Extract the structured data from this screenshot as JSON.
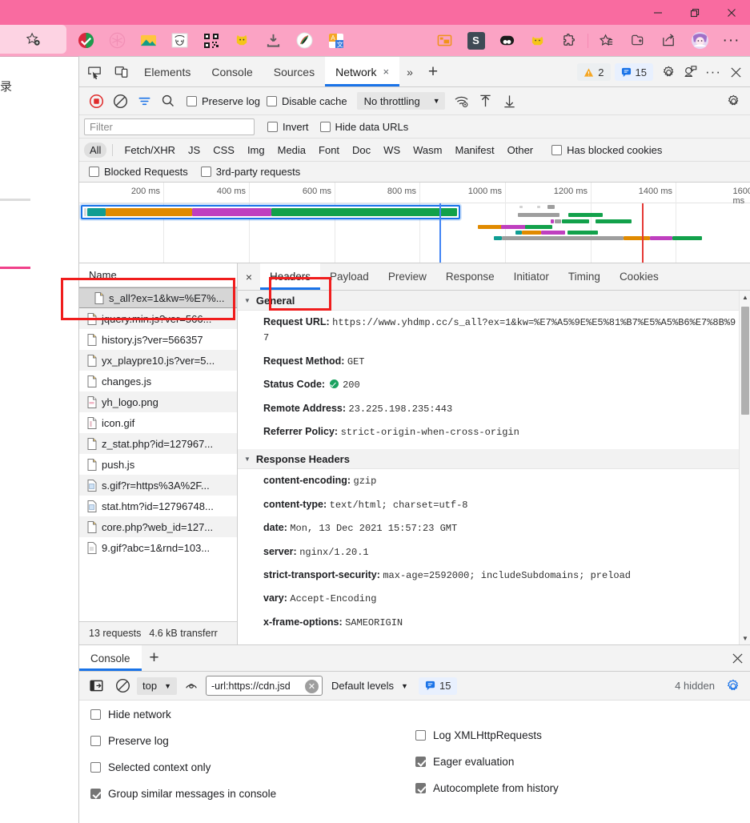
{
  "browser": {
    "window_controls": [
      "minimize",
      "restore",
      "close"
    ],
    "favorite_chip_icon": "add-favorite-star-icon",
    "extension_icons": [
      "adblock-icon",
      "flower-circle-icon",
      "image-icon",
      "anime-face-icon",
      "qr-code-icon",
      "cat-icon",
      "download-icon",
      "colorful-pen-icon",
      "translate-icon"
    ],
    "right_icons": [
      "picture-in-picture-icon",
      "s-extension-icon",
      "panda-icon",
      "cat2-icon",
      "puzzle-icon"
    ],
    "right_icons2": [
      "favorites-icon",
      "collections-icon",
      "share-icon",
      "profile-avatar",
      "more-icon"
    ]
  },
  "page_sliver": {
    "text": "录"
  },
  "devtools": {
    "tool_icons": [
      "inspect-element-icon",
      "device-toolbar-icon"
    ],
    "tabs": [
      {
        "label": "Elements",
        "active": false
      },
      {
        "label": "Console",
        "active": false
      },
      {
        "label": "Sources",
        "active": false
      },
      {
        "label": "Network",
        "active": true,
        "closable": true
      }
    ],
    "more_tabs_icon": "chevron-double-right-icon",
    "add_tab_icon": "plus-icon",
    "close_label": "×",
    "warnings": {
      "icon": "warning-triangle-icon",
      "count": "2"
    },
    "messages": {
      "icon": "message-bubble-icon",
      "count": "15"
    },
    "right_icons": [
      "settings-gear-icon",
      "customize-devtools-icon",
      "more-options-icon",
      "close-devtools-icon"
    ]
  },
  "network_toolbar": {
    "record_icon": "record-stop-icon",
    "clear_icon": "clear-circle-slash-icon",
    "filter_icon": "filter-icon",
    "search_icon": "search-icon",
    "preserve_log": {
      "label": "Preserve log",
      "checked": false
    },
    "disable_cache": {
      "label": "Disable cache",
      "checked": false
    },
    "throttling": {
      "value": "No throttling"
    },
    "wifi_icon": "network-conditions-wifi-icon",
    "upload_icon": "import-har-arrow-up-icon",
    "download_icon": "export-har-arrow-down-icon",
    "settings_icon": "settings-gear-icon"
  },
  "filter_row": {
    "placeholder": "Filter",
    "value": "",
    "invert": {
      "label": "Invert",
      "checked": false
    },
    "hide_data_urls": {
      "label": "Hide data URLs",
      "checked": false
    }
  },
  "type_filters": [
    {
      "label": "All",
      "active": true
    },
    {
      "label": "Fetch/XHR",
      "active": false
    },
    {
      "label": "JS",
      "active": false
    },
    {
      "label": "CSS",
      "active": false
    },
    {
      "label": "Img",
      "active": false
    },
    {
      "label": "Media",
      "active": false
    },
    {
      "label": "Font",
      "active": false
    },
    {
      "label": "Doc",
      "active": false
    },
    {
      "label": "WS",
      "active": false
    },
    {
      "label": "Wasm",
      "active": false
    },
    {
      "label": "Manifest",
      "active": false
    },
    {
      "label": "Other",
      "active": false
    }
  ],
  "has_blocked_cookies": {
    "label": "Has blocked cookies",
    "checked": false
  },
  "blocked_row": [
    {
      "label": "Blocked Requests",
      "checked": false
    },
    {
      "label": "3rd-party requests",
      "checked": false
    }
  ],
  "overview": {
    "tick_labels": [
      "200 ms",
      "400 ms",
      "600 ms",
      "800 ms",
      "1000 ms",
      "1200 ms",
      "1400 ms",
      "1600 ms"
    ],
    "dom_content_loaded_ms": 905,
    "load_event_ms": 1400
  },
  "request_list": {
    "column_header": "Name",
    "rows": [
      {
        "name": "s_all?ex=1&kw=%E7%...",
        "icon": "document-file-icon",
        "selected": true
      },
      {
        "name": "jquery.min.js?ver=566...",
        "icon": "script-file-icon",
        "selected": false
      },
      {
        "name": "history.js?ver=566357",
        "icon": "script-file-icon",
        "selected": false
      },
      {
        "name": "yx_playpre10.js?ver=5...",
        "icon": "script-file-icon",
        "selected": false
      },
      {
        "name": "changes.js",
        "icon": "script-file-icon",
        "selected": false
      },
      {
        "name": "yh_logo.png",
        "icon": "image-file-icon",
        "selected": false
      },
      {
        "name": "icon.gif",
        "icon": "image-file-icon",
        "selected": false
      },
      {
        "name": "z_stat.php?id=127967...",
        "icon": "script-file-icon",
        "selected": false
      },
      {
        "name": "push.js",
        "icon": "script-file-icon",
        "selected": false
      },
      {
        "name": "s.gif?r=https%3A%2F...",
        "icon": "image-file-icon",
        "selected": false
      },
      {
        "name": "stat.htm?id=12796748...",
        "icon": "document-file-icon",
        "selected": false
      },
      {
        "name": "core.php?web_id=127...",
        "icon": "script-file-icon",
        "selected": false
      },
      {
        "name": "9.gif?abc=1&rnd=103...",
        "icon": "image-file-icon",
        "selected": false
      }
    ],
    "status": {
      "requests": "13 requests",
      "transferred": "4.6 kB transferr"
    }
  },
  "detail": {
    "close_icon": "×",
    "tabs": [
      {
        "label": "Headers",
        "active": true
      },
      {
        "label": "Payload",
        "active": false
      },
      {
        "label": "Preview",
        "active": false
      },
      {
        "label": "Response",
        "active": false
      },
      {
        "label": "Initiator",
        "active": false
      },
      {
        "label": "Timing",
        "active": false
      },
      {
        "label": "Cookies",
        "active": false
      }
    ],
    "general": {
      "title": "General",
      "items": [
        {
          "key": "Request URL:",
          "value": "https://www.yhdmp.cc/s_all?ex=1&kw=%E7%A5%9E%E5%81%B7%E5%A5%B6%E7%8B%97"
        },
        {
          "key": "Request Method:",
          "value": "GET"
        },
        {
          "key": "Status Code:",
          "value": "200",
          "status_icon": "green-check-circle-icon"
        },
        {
          "key": "Remote Address:",
          "value": "23.225.198.235:443"
        },
        {
          "key": "Referrer Policy:",
          "value": "strict-origin-when-cross-origin"
        }
      ]
    },
    "response_headers": {
      "title": "Response Headers",
      "items": [
        {
          "key": "content-encoding:",
          "value": "gzip"
        },
        {
          "key": "content-type:",
          "value": "text/html; charset=utf-8"
        },
        {
          "key": "date:",
          "value": "Mon, 13 Dec 2021 15:57:23 GMT"
        },
        {
          "key": "server:",
          "value": "nginx/1.20.1"
        },
        {
          "key": "strict-transport-security:",
          "value": "max-age=2592000; includeSubdomains; preload"
        },
        {
          "key": "vary:",
          "value": "Accept-Encoding"
        },
        {
          "key": "x-frame-options:",
          "value": "SAMEORIGIN"
        }
      ]
    }
  },
  "drawer": {
    "tabs": [
      {
        "label": "Console",
        "active": true
      }
    ],
    "add_icon": "plus-icon",
    "close_icon": "×",
    "toolbar": {
      "sidebar_icon": "console-sidebar-icon",
      "clear_icon": "clear-console-icon",
      "context": "top",
      "eye_icon": "live-expression-eye-icon",
      "filter_value": "-url:https://cdn.jsd",
      "filter_placeholder": "Filter",
      "clear_filter_icon": "clear-input-icon",
      "levels": "Default levels",
      "message_count": "15",
      "message_icon": "message-bubble-icon",
      "hidden": "4 hidden",
      "settings_icon": "settings-gear-icon"
    },
    "settings_left": [
      {
        "label": "Hide network",
        "checked": false
      },
      {
        "label": "Preserve log",
        "checked": false
      },
      {
        "label": "Selected context only",
        "checked": false
      },
      {
        "label": "Group similar messages in console",
        "checked": true
      }
    ],
    "settings_right": [
      {
        "label": "Log XMLHttpRequests",
        "checked": false
      },
      {
        "label": "Eager evaluation",
        "checked": true
      },
      {
        "label": "Autocomplete from history",
        "checked": true
      }
    ]
  },
  "colors": {
    "titlebar": "#f96ba0",
    "toolbar": "#fba3c4",
    "accent_blue": "#1a73e8",
    "annotation_red": "#f01d1d",
    "status_green": "#1aa260",
    "waterfall": [
      "#0f9d93",
      "#e08a00",
      "#bf3fbf",
      "#12a14b",
      "#9e9e9e"
    ]
  }
}
